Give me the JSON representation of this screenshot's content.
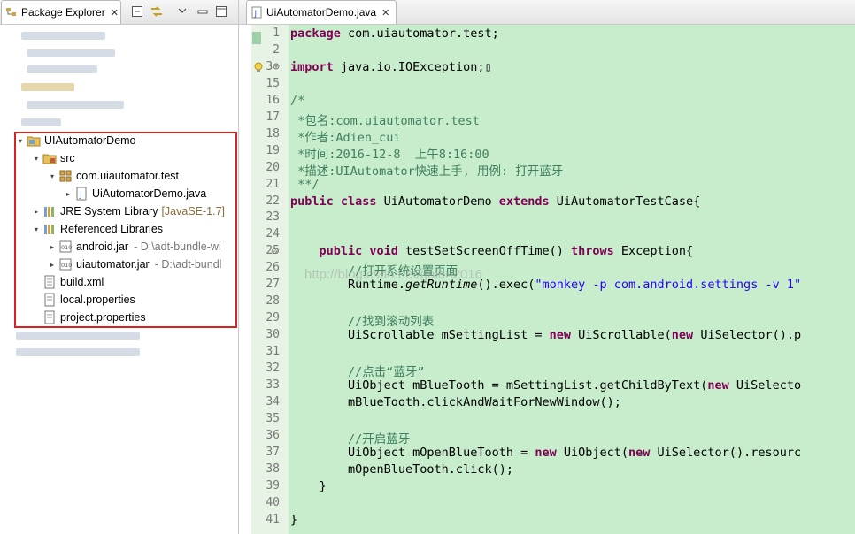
{
  "left_panel": {
    "tab_label": "Package Explorer",
    "close_glyph": "✕",
    "toolbar_icons": [
      "collapse-all-icon",
      "link-with-editor-icon",
      "view-menu-icon",
      "minimize-icon",
      "maximize-icon"
    ],
    "tree": [
      {
        "label": "UIAutomatorDemo",
        "icon": "project-icon",
        "arrow": "▾",
        "level": 0
      },
      {
        "label": "src",
        "icon": "source-folder-icon",
        "arrow": "▾",
        "level": 1
      },
      {
        "label": "com.uiautomator.test",
        "icon": "package-icon",
        "arrow": "▾",
        "level": 2
      },
      {
        "label": "UiAutomatorDemo.java",
        "icon": "java-file-icon",
        "arrow": "▸",
        "level": 3
      },
      {
        "label": "JRE System Library",
        "extra": "[JavaSE-1.7]",
        "icon": "library-icon",
        "arrow": "▸",
        "level": 1
      },
      {
        "label": "Referenced Libraries",
        "icon": "library-icon",
        "arrow": "▾",
        "level": 1
      },
      {
        "label": "android.jar",
        "extra": "- D:\\adt-bundle-wi",
        "icon": "jar-icon",
        "arrow": "▸",
        "level": 2
      },
      {
        "label": "uiautomator.jar",
        "extra": "- D:\\adt-bundl",
        "icon": "jar-icon",
        "arrow": "▸",
        "level": 2
      },
      {
        "label": "build.xml",
        "icon": "xml-file-icon",
        "arrow": "",
        "level": 1
      },
      {
        "label": "local.properties",
        "icon": "properties-file-icon",
        "arrow": "",
        "level": 1
      },
      {
        "label": "project.properties",
        "icon": "properties-file-icon",
        "arrow": "",
        "level": 1
      }
    ]
  },
  "editor": {
    "tab_label": "UiAutomatorDemo.java",
    "close_glyph": "✕",
    "watermark": "http://blog.csdn.net/galen2016",
    "lines": [
      {
        "n": "1",
        "parts": [
          [
            "kw",
            "package"
          ],
          [
            "",
            "com.uiautomator.test;"
          ]
        ]
      },
      {
        "n": "2",
        "parts": []
      },
      {
        "n": "3⊕",
        "parts": [
          [
            "kw",
            "import"
          ],
          [
            "",
            "java.io.IOException;▯"
          ]
        ]
      },
      {
        "n": "15",
        "parts": []
      },
      {
        "n": "16",
        "parts": [
          [
            "cm",
            "/*"
          ]
        ]
      },
      {
        "n": "17",
        "parts": [
          [
            "cm",
            " *包名:com.uiautomator.test"
          ]
        ]
      },
      {
        "n": "18",
        "parts": [
          [
            "cm",
            " *作者:Adien_cui"
          ]
        ]
      },
      {
        "n": "19",
        "parts": [
          [
            "cm",
            " *时间:2016-12-8  上午8:16:00"
          ]
        ]
      },
      {
        "n": "20",
        "parts": [
          [
            "cm",
            " *描述:UIAutomator快速上手, 用例: 打开蓝牙"
          ]
        ]
      },
      {
        "n": "21",
        "parts": [
          [
            "cm",
            " **/"
          ]
        ]
      },
      {
        "n": "22",
        "parts": [
          [
            "kw",
            "public class"
          ],
          [
            "",
            " UiAutomatorDemo "
          ],
          [
            "kw",
            "extends"
          ],
          [
            "",
            " UiAutomatorTestCase{"
          ]
        ]
      },
      {
        "n": "23",
        "parts": []
      },
      {
        "n": "24",
        "parts": []
      },
      {
        "n": "25",
        "parts": [
          [
            "",
            "    "
          ],
          [
            "kw",
            "public void"
          ],
          [
            "",
            " testSetScreenOffTime() "
          ],
          [
            "kw",
            "throws"
          ],
          [
            "",
            " Exception{"
          ]
        ]
      },
      {
        "n": "26",
        "parts": [
          [
            "cm",
            "        //打开系统设置页面"
          ]
        ]
      },
      {
        "n": "27",
        "parts": [
          [
            "",
            "        Runtime."
          ],
          [
            "it",
            "getRuntime"
          ],
          [
            "",
            "().exec("
          ],
          [
            "st",
            "\"monkey -p com.android.settings -v 1\""
          ]
        ]
      },
      {
        "n": "28",
        "parts": []
      },
      {
        "n": "29",
        "parts": [
          [
            "cm",
            "        //找到滚动列表"
          ]
        ]
      },
      {
        "n": "30",
        "parts": [
          [
            "",
            "        UiScrollable mSettingList = "
          ],
          [
            "kw",
            "new"
          ],
          [
            "",
            " UiScrollable("
          ],
          [
            "kw",
            "new"
          ],
          [
            "",
            " UiSelector().p"
          ]
        ]
      },
      {
        "n": "31",
        "parts": []
      },
      {
        "n": "32",
        "parts": [
          [
            "cm",
            "        //点击“蓝牙”"
          ]
        ]
      },
      {
        "n": "33",
        "parts": [
          [
            "",
            "        UiObject mBlueTooth = mSettingList.getChildByText("
          ],
          [
            "kw",
            "new"
          ],
          [
            "",
            " UiSelecto"
          ]
        ]
      },
      {
        "n": "34",
        "parts": [
          [
            "",
            "        mBlueTooth.clickAndWaitForNewWindow();"
          ]
        ]
      },
      {
        "n": "35",
        "parts": []
      },
      {
        "n": "36",
        "parts": [
          [
            "cm",
            "        //开启蓝牙"
          ]
        ]
      },
      {
        "n": "37",
        "parts": [
          [
            "",
            "        UiObject mOpenBlueTooth = "
          ],
          [
            "kw",
            "new"
          ],
          [
            "",
            " UiObject("
          ],
          [
            "kw",
            "new"
          ],
          [
            "",
            " UiSelector().resourc"
          ]
        ]
      },
      {
        "n": "38",
        "parts": [
          [
            "",
            "        mOpenBlueTooth.click();"
          ]
        ]
      },
      {
        "n": "39",
        "parts": [
          [
            "",
            "    }"
          ]
        ]
      },
      {
        "n": "40",
        "parts": []
      },
      {
        "n": "41",
        "parts": [
          [
            "",
            "}"
          ]
        ]
      }
    ]
  },
  "colors": {
    "keyword": "#7f0055",
    "comment": "#3f7f5f",
    "string": "#2a00ff",
    "editor_background": "#c7edcc",
    "selection_box": "#e02020"
  }
}
